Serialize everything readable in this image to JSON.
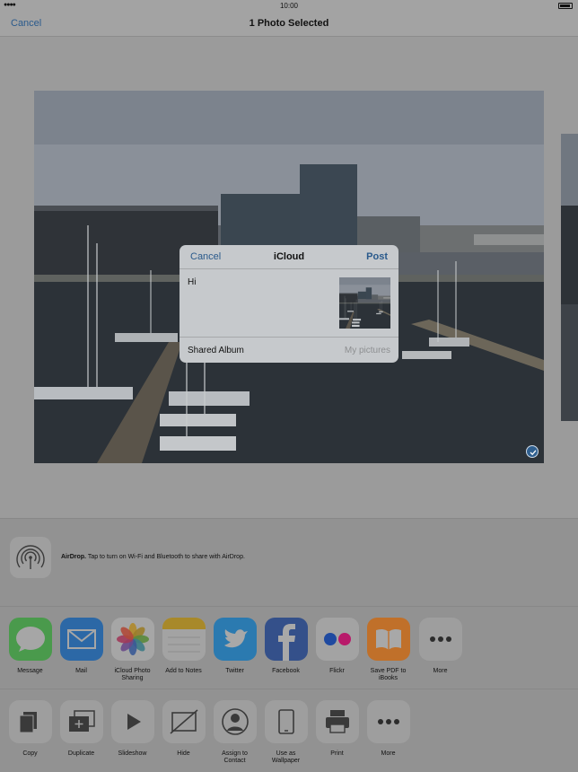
{
  "status_bar": {
    "signal": "●●●●",
    "time": "10:00"
  },
  "nav": {
    "cancel_label": "Cancel",
    "title": "1 Photo Selected"
  },
  "icloud_sheet": {
    "cancel_label": "Cancel",
    "title": "iCloud",
    "post_label": "Post",
    "message": "Hi",
    "album_label": "Shared Album",
    "album_value": "My pictures"
  },
  "airdrop": {
    "title": "AirDrop.",
    "description": " Tap to turn on Wi-Fi and Bluetooth to share with AirDrop."
  },
  "share_apps": [
    {
      "label": "Message",
      "icon": "message-icon"
    },
    {
      "label": "Mail",
      "icon": "mail-icon"
    },
    {
      "label": "iCloud Photo\nSharing",
      "icon": "photos-icon"
    },
    {
      "label": "Add to Notes",
      "icon": "notes-icon"
    },
    {
      "label": "Twitter",
      "icon": "twitter-icon"
    },
    {
      "label": "Facebook",
      "icon": "facebook-icon"
    },
    {
      "label": "Flickr",
      "icon": "flickr-icon"
    },
    {
      "label": "Save PDF to\niBooks",
      "icon": "ibooks-icon"
    },
    {
      "label": "More",
      "icon": "more-icon"
    }
  ],
  "actions": [
    {
      "label": "Copy",
      "icon": "copy-icon"
    },
    {
      "label": "Duplicate",
      "icon": "duplicate-icon"
    },
    {
      "label": "Slideshow",
      "icon": "play-icon"
    },
    {
      "label": "Hide",
      "icon": "hide-icon"
    },
    {
      "label": "Assign to\nContact",
      "icon": "contact-icon"
    },
    {
      "label": "Use as\nWallpaper",
      "icon": "wallpaper-icon"
    },
    {
      "label": "Print",
      "icon": "print-icon"
    },
    {
      "label": "More",
      "icon": "more-icon"
    }
  ],
  "colors": {
    "accent": "#2a5a8c",
    "dim_overlay": "#9b9b9b"
  }
}
